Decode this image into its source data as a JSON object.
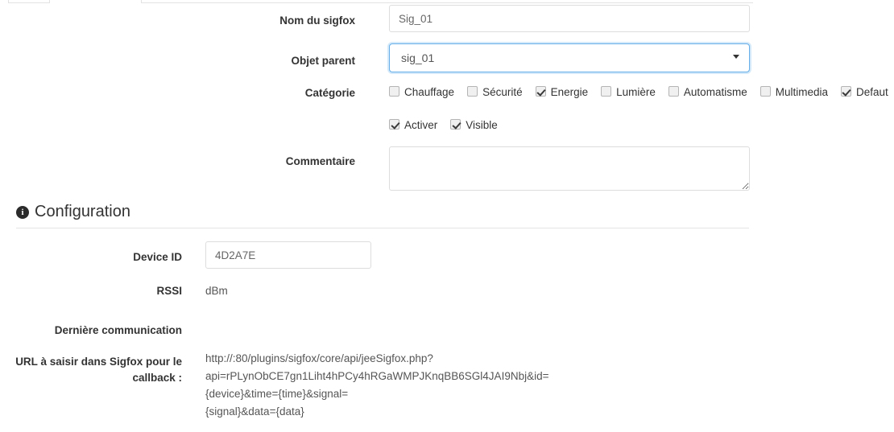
{
  "form": {
    "name_field": {
      "label": "Nom du sigfox",
      "value": "Sig_01",
      "placeholder": "Nom du sigfox"
    },
    "parent_field": {
      "label": "Objet parent",
      "value": "sig_01",
      "options": [
        "sig_01"
      ]
    },
    "category_field": {
      "label": "Catégorie",
      "items": [
        {
          "label": "Chauffage",
          "checked": false
        },
        {
          "label": "Sécurité",
          "checked": false
        },
        {
          "label": "Energie",
          "checked": true
        },
        {
          "label": "Lumière",
          "checked": false
        },
        {
          "label": "Automatisme",
          "checked": false
        },
        {
          "label": "Multimedia",
          "checked": false
        },
        {
          "label": "Defaut",
          "checked": true
        }
      ]
    },
    "toggles": [
      {
        "label": "Activer",
        "checked": true
      },
      {
        "label": "Visible",
        "checked": true
      }
    ],
    "comment_field": {
      "label": "Commentaire",
      "value": "",
      "placeholder": ""
    }
  },
  "configuration": {
    "title": "Configuration",
    "icon": "info-circle-icon",
    "device_id": {
      "label": "Device ID",
      "value": "4D2A7E",
      "placeholder": "Device ID"
    },
    "rssi": {
      "label": "RSSI",
      "value": "dBm"
    },
    "last_communication": {
      "label": "Dernière communication",
      "value": ""
    },
    "callback_url": {
      "label": "URL à saisir dans Sigfox pour le callback :",
      "lines": [
        "http://:80/plugins/sigfox/core/api/jeeSigfox.php?",
        "api=rPLynObCE7gn1Liht4hPCy4hRGaWMPJKnqBB6SGl4JAI9Nbj&id=",
        "{device}&time={time}&signal=",
        "{signal}&data={data}"
      ]
    }
  },
  "colors": {
    "focus_blue": "#66afe9",
    "border_gray": "#dddddd",
    "text": "#333333",
    "muted_text": "#555555"
  }
}
